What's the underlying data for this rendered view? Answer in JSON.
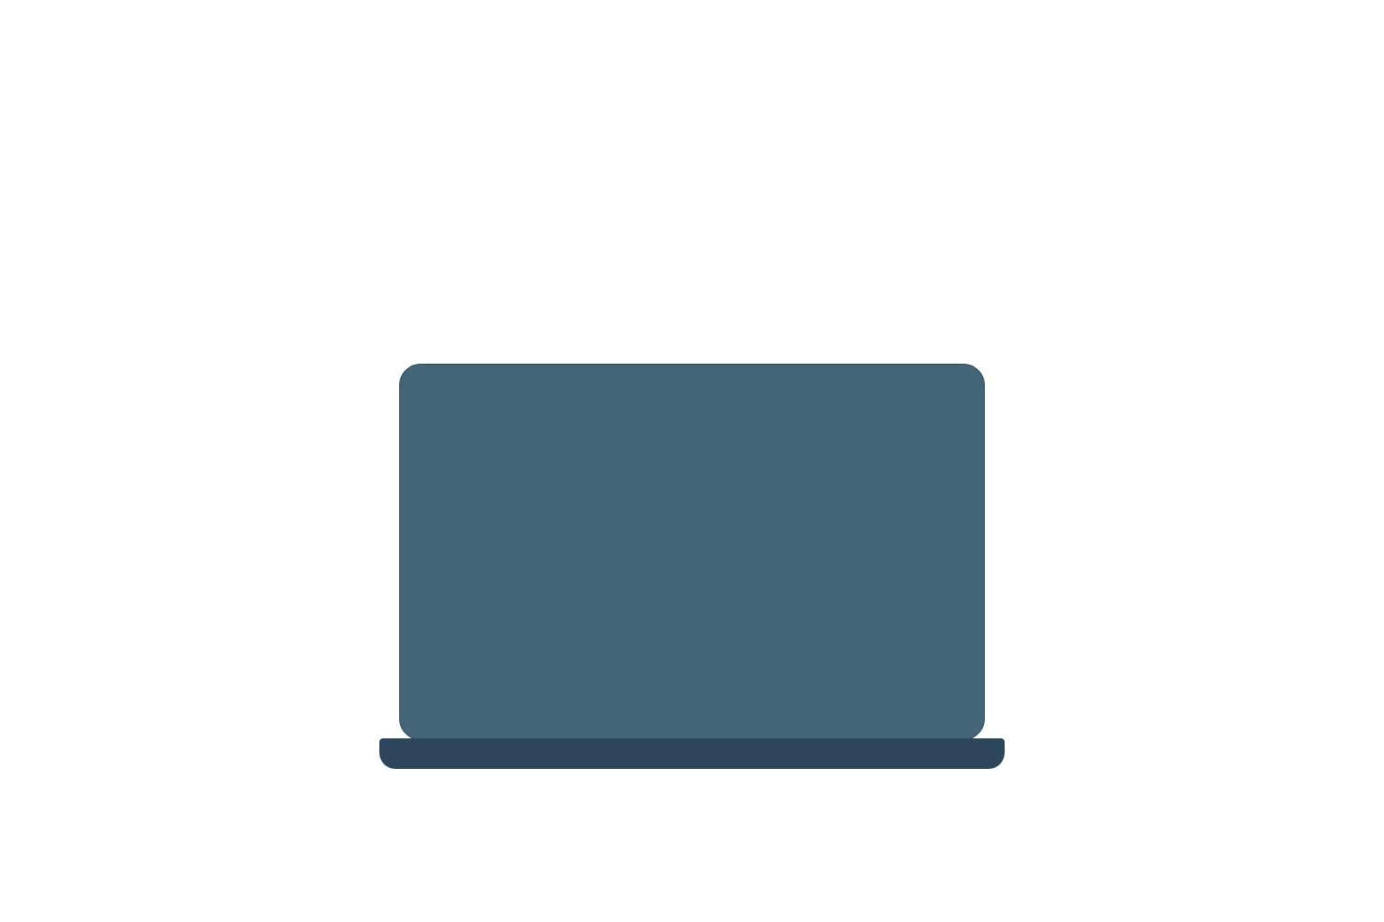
{
  "scene": {
    "background_color": "#ffffff",
    "laptop": {
      "icon": "laptop-icon",
      "screen_color": "#446578",
      "base_color": "#2e465b"
    }
  }
}
